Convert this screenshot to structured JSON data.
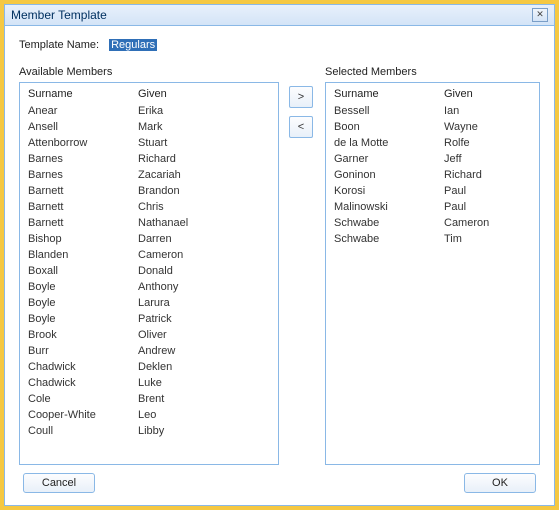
{
  "window": {
    "title": "Member Template",
    "close_icon": "✕"
  },
  "template_name": {
    "label": "Template Name:",
    "value": "Regulars"
  },
  "available": {
    "label": "Available Members",
    "columns": {
      "surname": "Surname",
      "given": "Given"
    },
    "rows": [
      {
        "surname": "Anear",
        "given": "Erika"
      },
      {
        "surname": "Ansell",
        "given": "Mark"
      },
      {
        "surname": "Attenborrow",
        "given": "Stuart"
      },
      {
        "surname": "Barnes",
        "given": "Richard"
      },
      {
        "surname": "Barnes",
        "given": "Zacariah"
      },
      {
        "surname": "Barnett",
        "given": "Brandon"
      },
      {
        "surname": "Barnett",
        "given": "Chris"
      },
      {
        "surname": "Barnett",
        "given": "Nathanael"
      },
      {
        "surname": "Bishop",
        "given": "Darren"
      },
      {
        "surname": "Blanden",
        "given": "Cameron"
      },
      {
        "surname": "Boxall",
        "given": "Donald"
      },
      {
        "surname": "Boyle",
        "given": "Anthony"
      },
      {
        "surname": "Boyle",
        "given": "Larura"
      },
      {
        "surname": "Boyle",
        "given": "Patrick"
      },
      {
        "surname": "Brook",
        "given": "Oliver"
      },
      {
        "surname": "Burr",
        "given": "Andrew"
      },
      {
        "surname": "Chadwick",
        "given": "Deklen"
      },
      {
        "surname": "Chadwick",
        "given": "Luke"
      },
      {
        "surname": "Cole",
        "given": "Brent"
      },
      {
        "surname": "Cooper-White",
        "given": "Leo"
      },
      {
        "surname": "Coull",
        "given": "Libby"
      }
    ]
  },
  "selected": {
    "label": "Selected Members",
    "columns": {
      "surname": "Surname",
      "given": "Given"
    },
    "rows": [
      {
        "surname": "Bessell",
        "given": "Ian"
      },
      {
        "surname": "Boon",
        "given": "Wayne"
      },
      {
        "surname": "de la Motte",
        "given": "Rolfe"
      },
      {
        "surname": "Garner",
        "given": "Jeff"
      },
      {
        "surname": "Goninon",
        "given": "Richard"
      },
      {
        "surname": "Korosi",
        "given": "Paul"
      },
      {
        "surname": "Malinowski",
        "given": "Paul"
      },
      {
        "surname": "Schwabe",
        "given": "Cameron"
      },
      {
        "surname": "Schwabe",
        "given": "Tim"
      }
    ]
  },
  "buttons": {
    "move_right": ">",
    "move_left": "<",
    "cancel": "Cancel",
    "ok": "OK"
  }
}
